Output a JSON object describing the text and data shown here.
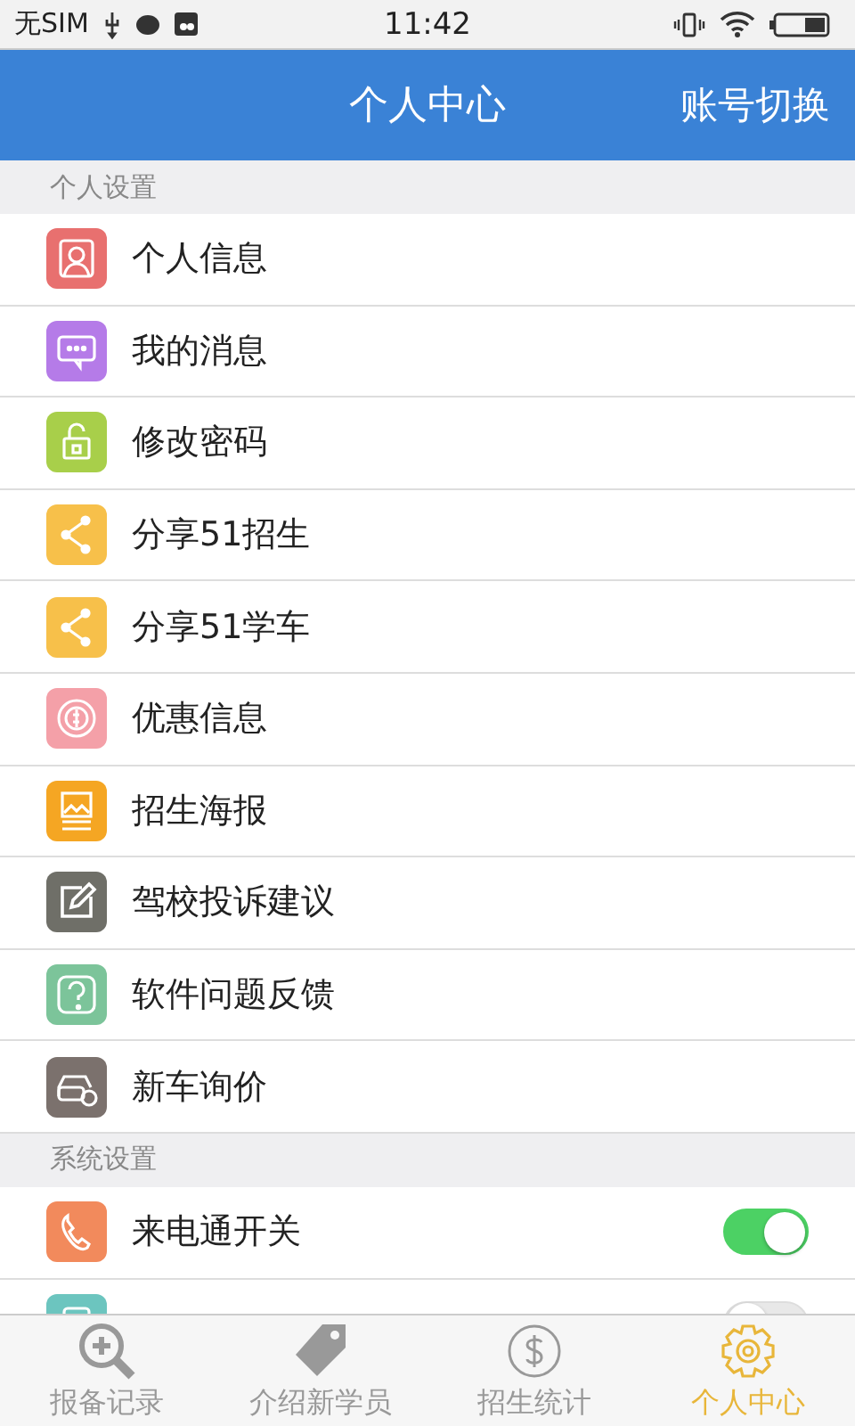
{
  "status_bar": {
    "carrier": "无SIM",
    "time": "11:42"
  },
  "header": {
    "title": "个人中心",
    "action": "账号切换"
  },
  "sections": [
    {
      "title": "个人设置",
      "items": [
        {
          "kind": "person",
          "label": "个人信息"
        },
        {
          "kind": "chat",
          "label": "我的消息"
        },
        {
          "kind": "lock",
          "label": "修改密码"
        },
        {
          "kind": "share",
          "label": "分享51招生"
        },
        {
          "kind": "share",
          "label": "分享51学车"
        },
        {
          "kind": "coupon",
          "label": "优惠信息"
        },
        {
          "kind": "poster",
          "label": "招生海报"
        },
        {
          "kind": "edit",
          "label": "驾校投诉建议"
        },
        {
          "kind": "help",
          "label": "软件问题反馈"
        },
        {
          "kind": "car",
          "label": "新车询价"
        }
      ]
    },
    {
      "title": "系统设置",
      "items": [
        {
          "kind": "phone",
          "label": "来电通开关",
          "on": true
        },
        {
          "kind": "screen",
          "on": false
        }
      ]
    }
  ],
  "tabs": [
    {
      "kind": "search",
      "label": "报备记录",
      "selected": false
    },
    {
      "kind": "tag",
      "label": "介绍新学员",
      "selected": false
    },
    {
      "kind": "dollar",
      "label": "招生统计",
      "selected": false
    },
    {
      "kind": "gear",
      "label": "个人中心",
      "selected": true
    }
  ]
}
